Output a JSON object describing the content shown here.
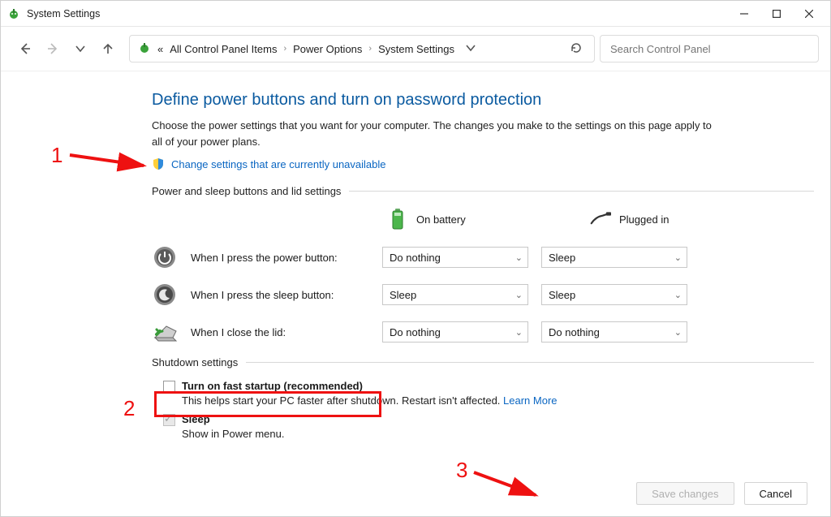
{
  "window": {
    "title": "System Settings"
  },
  "breadcrumb": {
    "prefix": "«",
    "root": "All Control Panel Items",
    "level1": "Power Options",
    "level2": "System Settings"
  },
  "search": {
    "placeholder": "Search Control Panel"
  },
  "page": {
    "title": "Define power buttons and turn on password protection",
    "description": "Choose the power settings that you want for your computer. The changes you make to the settings on this page apply to all of your power plans.",
    "change_link": "Change settings that are currently unavailable"
  },
  "sections": {
    "power_lid_label": "Power and sleep buttons and lid settings",
    "shutdown_label": "Shutdown settings"
  },
  "columns": {
    "battery": "On battery",
    "plugged": "Plugged in"
  },
  "rows": {
    "power_button": {
      "label": "When I press the power button:",
      "battery": "Do nothing",
      "plugged": "Sleep"
    },
    "sleep_button": {
      "label": "When I press the sleep button:",
      "battery": "Sleep",
      "plugged": "Sleep"
    },
    "lid": {
      "label": "When I close the lid:",
      "battery": "Do nothing",
      "plugged": "Do nothing"
    }
  },
  "shutdown": {
    "fast_startup_label": "Turn on fast startup (recommended)",
    "fast_startup_help": "This helps start your PC faster after shutdown. Restart isn't affected. ",
    "learn_more": "Learn More",
    "sleep_label": "Sleep",
    "sleep_help": "Show in Power menu."
  },
  "footer": {
    "save": "Save changes",
    "cancel": "Cancel"
  },
  "annotations": {
    "n1": "1",
    "n2": "2",
    "n3": "3"
  }
}
